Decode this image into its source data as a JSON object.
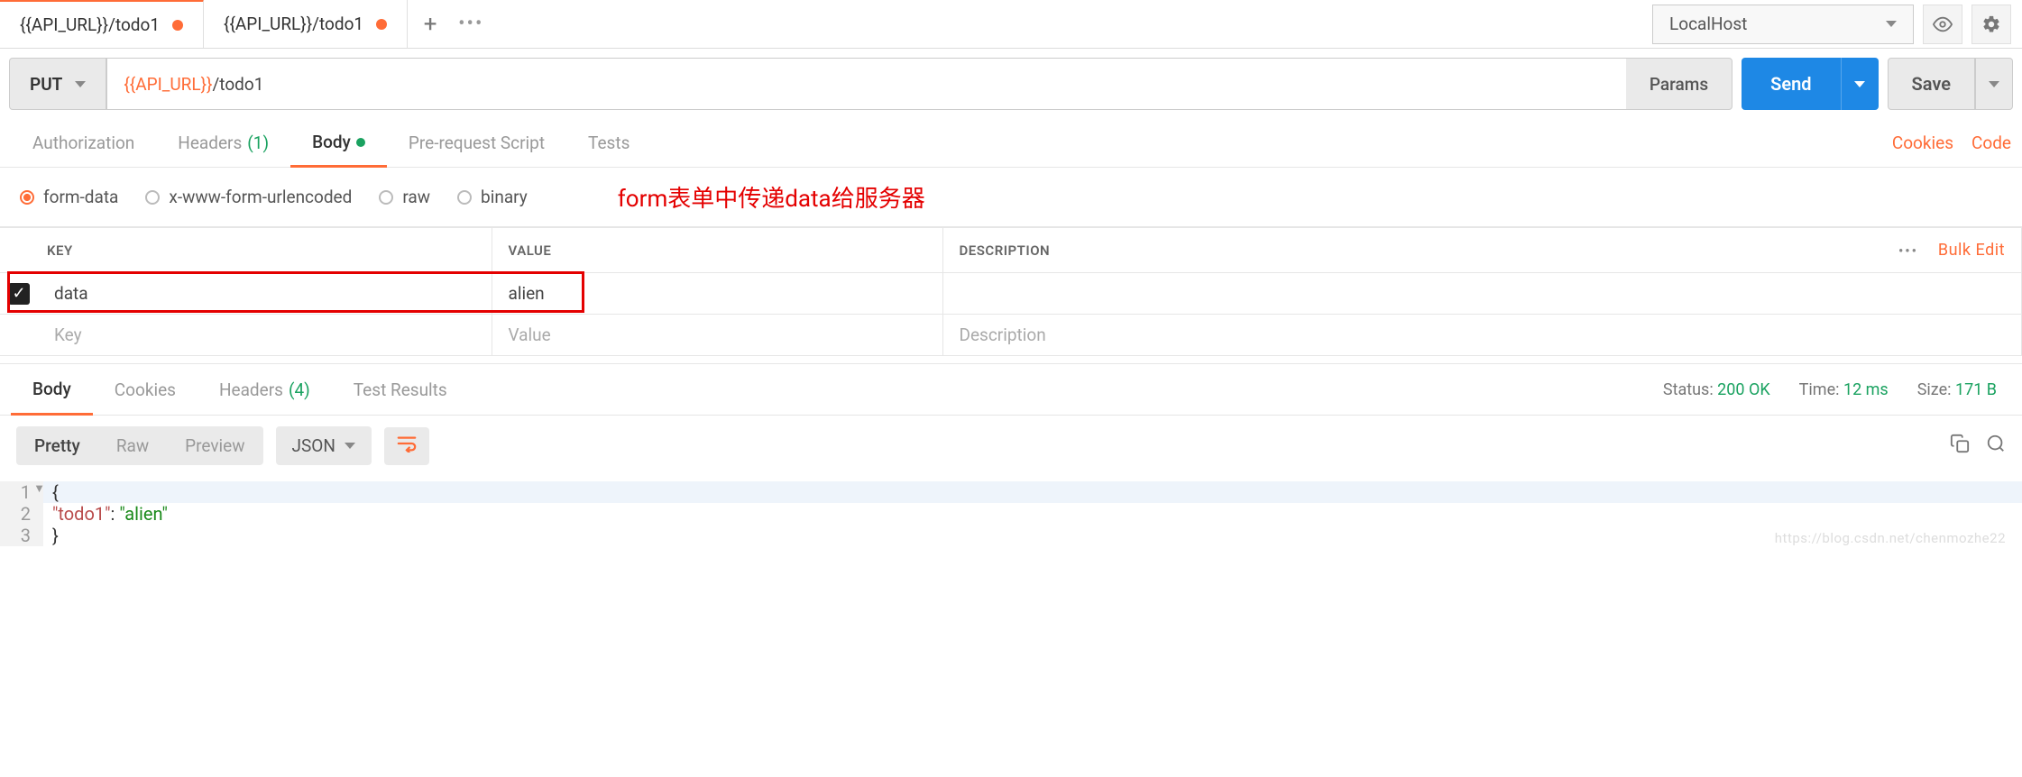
{
  "tabs": [
    {
      "title": "{{API_URL}}/todo1",
      "dirty": true,
      "active": true
    },
    {
      "title": "{{API_URL}}/todo1",
      "dirty": true,
      "active": false
    }
  ],
  "environment": {
    "selected": "LocalHost"
  },
  "request": {
    "method": "PUT",
    "url_var": "{{API_URL}}",
    "url_path": "/todo1",
    "params_label": "Params",
    "send_label": "Send",
    "save_label": "Save"
  },
  "req_tabs": {
    "authorization": "Authorization",
    "headers": "Headers",
    "headers_count": "(1)",
    "body": "Body",
    "prerequest": "Pre-request Script",
    "tests": "Tests",
    "cookies_link": "Cookies",
    "code_link": "Code"
  },
  "body_types": {
    "formdata": "form-data",
    "urlencoded": "x-www-form-urlencoded",
    "raw": "raw",
    "binary": "binary"
  },
  "annotation": "form表单中传递data给服务器",
  "form_table": {
    "headers": {
      "key": "KEY",
      "value": "VALUE",
      "description": "DESCRIPTION"
    },
    "bulk_edit": "Bulk Edit",
    "rows": [
      {
        "checked": true,
        "key": "data",
        "value": "alien",
        "description": ""
      }
    ],
    "placeholder": {
      "key": "Key",
      "value": "Value",
      "description": "Description"
    }
  },
  "resp_tabs": {
    "body": "Body",
    "cookies": "Cookies",
    "headers": "Headers",
    "headers_count": "(4)",
    "tests": "Test Results"
  },
  "resp_meta": {
    "status_label": "Status:",
    "status": "200 OK",
    "time_label": "Time:",
    "time": "12 ms",
    "size_label": "Size:",
    "size": "171 B"
  },
  "view_bar": {
    "pretty": "Pretty",
    "raw": "Raw",
    "preview": "Preview",
    "format": "JSON"
  },
  "code_lines": [
    {
      "n": "1",
      "content": "{"
    },
    {
      "n": "2",
      "indent": "    ",
      "key": "\"todo1\"",
      "sep": ": ",
      "val": "\"alien\""
    },
    {
      "n": "3",
      "content": "}"
    }
  ],
  "watermark": "https://blog.csdn.net/chenmozhe22"
}
